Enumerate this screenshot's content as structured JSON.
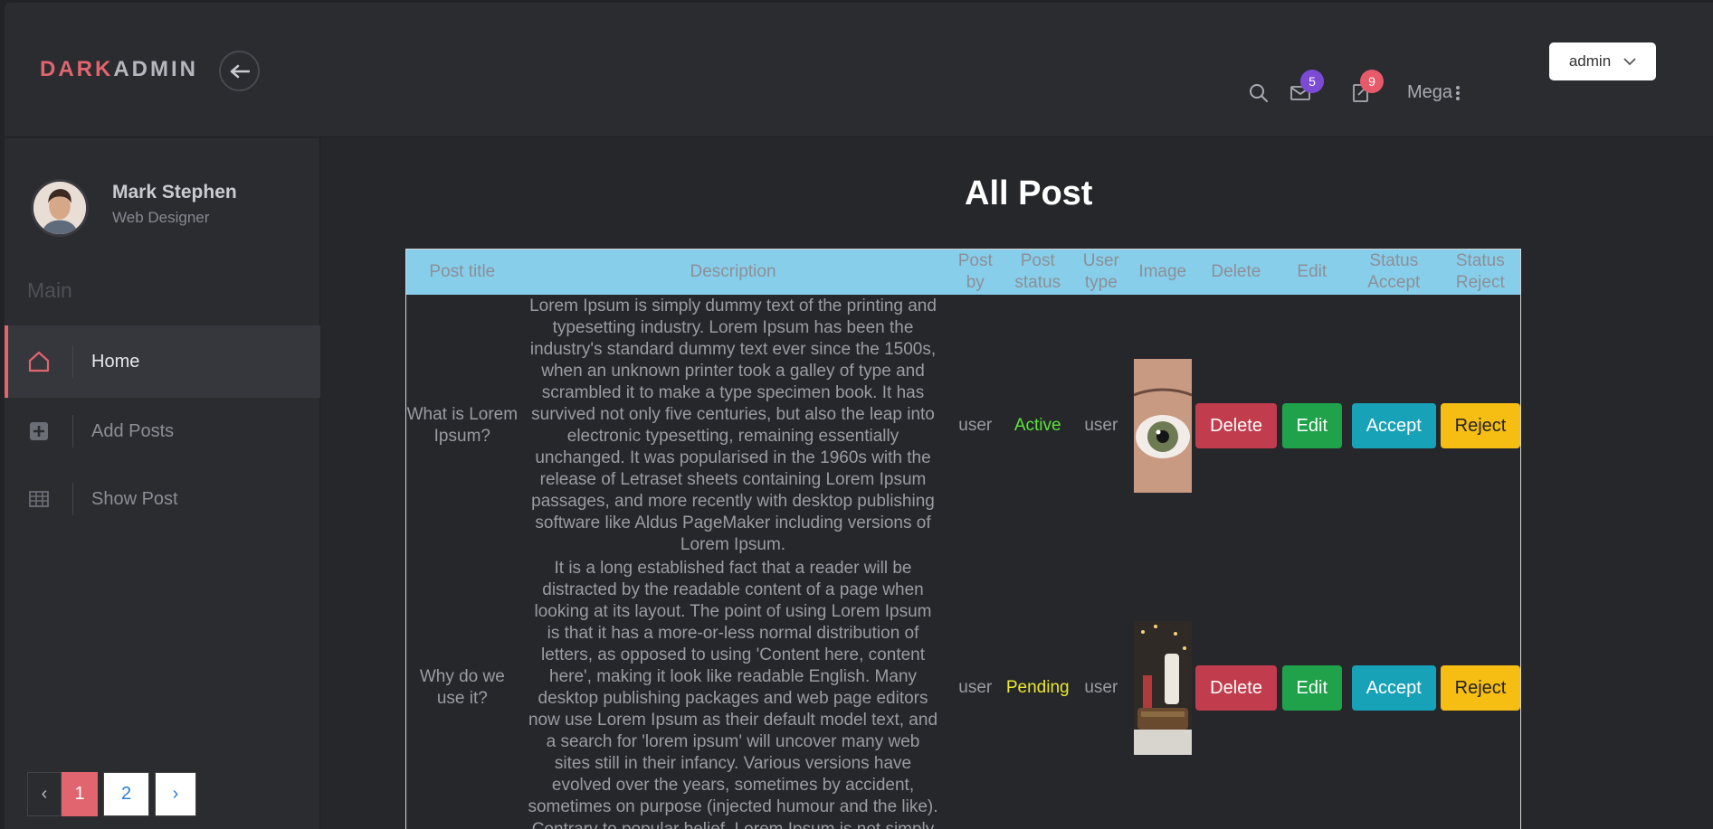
{
  "brand": {
    "part1": "DARK",
    "part2": "ADMIN"
  },
  "header": {
    "mail_count": "5",
    "notes_count": "9",
    "mega_label": "Mega",
    "admin_label": "admin"
  },
  "sidebar": {
    "user_name": "Mark Stephen",
    "user_role": "Web Designer",
    "section_label": "Main",
    "items": [
      {
        "label": "Home",
        "icon": "home-icon"
      },
      {
        "label": "Add Posts",
        "icon": "plus-square-icon"
      },
      {
        "label": "Show Post",
        "icon": "table-icon"
      }
    ],
    "pagination": {
      "prev": "‹",
      "current": "1",
      "page2": "2",
      "next": "›"
    }
  },
  "main": {
    "title": "All Post",
    "columns": [
      "Post title",
      "Description",
      "Post by",
      "Post status",
      "User type",
      "Image",
      "Delete",
      "Edit",
      "Status Accept",
      "Status Reject"
    ],
    "rows": [
      {
        "title": "What is Lorem Ipsum?",
        "description": "Lorem Ipsum is simply dummy text of the printing and typesetting industry. Lorem Ipsum has been the industry's standard dummy text ever since the 1500s, when an unknown printer took a galley of type and scrambled it to make a type specimen book. It has survived not only five centuries, but also the leap into electronic typesetting, remaining essentially unchanged. It was popularised in the 1960s with the release of Letraset sheets containing Lorem Ipsum passages, and more recently with desktop publishing software like Aldus PageMaker including versions of Lorem Ipsum.",
        "post_by": "user",
        "status": "Active",
        "user_type": "user",
        "delete": "Delete",
        "edit": "Edit",
        "accept": "Accept",
        "reject": "Reject"
      },
      {
        "title": "Why do we use it?",
        "description": "It is a long established fact that a reader will be distracted by the readable content of a page when looking at its layout. The point of using Lorem Ipsum is that it has a more-or-less normal distribution of letters, as opposed to using 'Content here, content here', making it look like readable English. Many desktop publishing packages and web page editors now use Lorem Ipsum as their default model text, and a search for 'lorem ipsum' will uncover many web sites still in their infancy. Various versions have evolved over the years, sometimes by accident, sometimes on purpose (injected humour and the like).",
        "post_by": "user",
        "status": "Pending",
        "user_type": "user",
        "delete": "Delete",
        "edit": "Edit",
        "accept": "Accept",
        "reject": "Reject"
      },
      {
        "title": "",
        "description": "Contrary to popular belief, Lorem Ipsum is not simply",
        "post_by": "",
        "status": "",
        "user_type": "",
        "delete": "",
        "edit": "",
        "accept": "",
        "reject": ""
      }
    ]
  },
  "colors": {
    "accent": "#e0656e",
    "table_header": "#87ceeb",
    "active": "#5ce33a",
    "pending": "#e8e832"
  }
}
